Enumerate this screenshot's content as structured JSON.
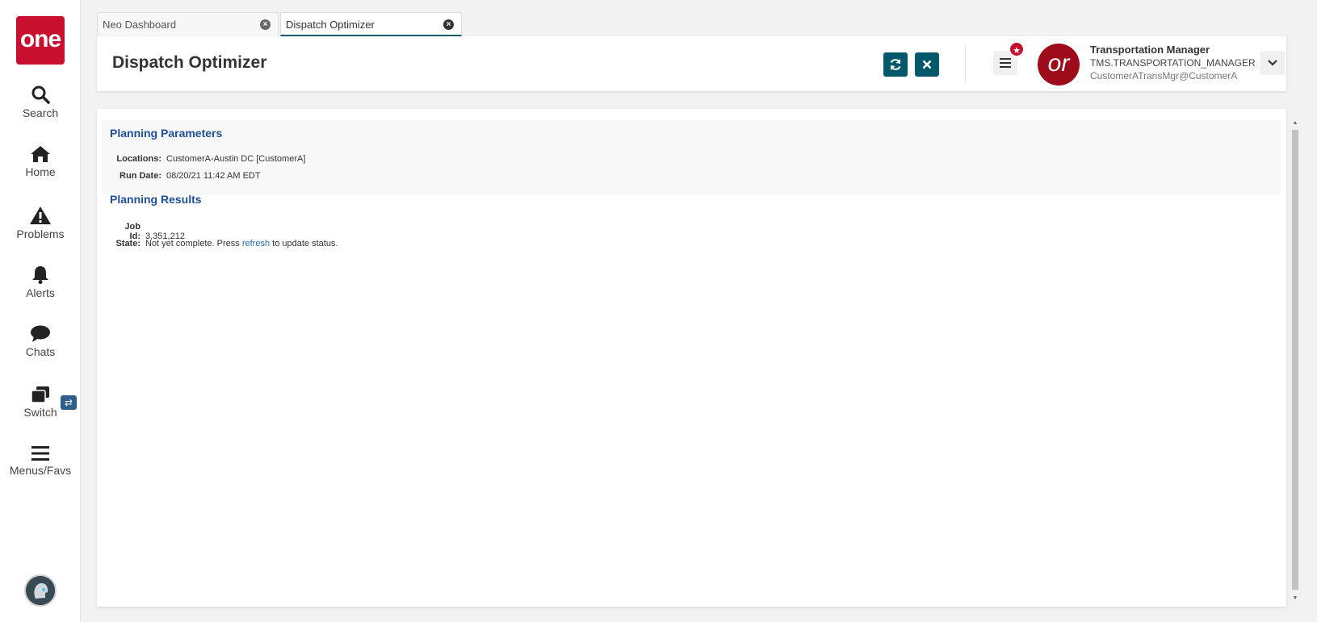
{
  "sidebar": {
    "logo": "one",
    "items": [
      {
        "label": "Search",
        "icon": "search-icon"
      },
      {
        "label": "Home",
        "icon": "home-icon"
      },
      {
        "label": "Problems",
        "icon": "warning-icon"
      },
      {
        "label": "Alerts",
        "icon": "bell-icon"
      },
      {
        "label": "Chats",
        "icon": "chat-icon"
      },
      {
        "label": "Switch",
        "icon": "switch-icon"
      },
      {
        "label": "Menus/Favs",
        "icon": "menu-icon"
      }
    ],
    "switch_badge": "⇄"
  },
  "tabs": [
    {
      "label": "Neo Dashboard",
      "active": false
    },
    {
      "label": "Dispatch Optimizer",
      "active": true
    }
  ],
  "header": {
    "title": "Dispatch Optimizer",
    "refresh_icon": "refresh-icon",
    "close_icon": "close-icon"
  },
  "user": {
    "initials": "or",
    "name": "Transportation Manager",
    "role": "TMS.TRANSPORTATION_MANAGER",
    "email": "CustomerATransMgr@CustomerA"
  },
  "planning_parameters": {
    "title": "Planning Parameters",
    "locations_label": "Locations:",
    "locations_value": "CustomerA-Austin DC [CustomerA]",
    "run_date_label": "Run Date:",
    "run_date_value": "08/20/21 11:42 AM EDT"
  },
  "planning_results": {
    "title": "Planning Results",
    "job_id_label": "Job Id:",
    "job_id_value": "3,351,212",
    "state_label": "State:",
    "state_prefix": "Not yet complete. Press",
    "state_link": "refresh",
    "state_suffix": "to update status."
  },
  "colors": {
    "brand": "#c8102e",
    "accent": "#00596b",
    "section_title": "#1f4e9b",
    "link": "#1f6fb2"
  }
}
